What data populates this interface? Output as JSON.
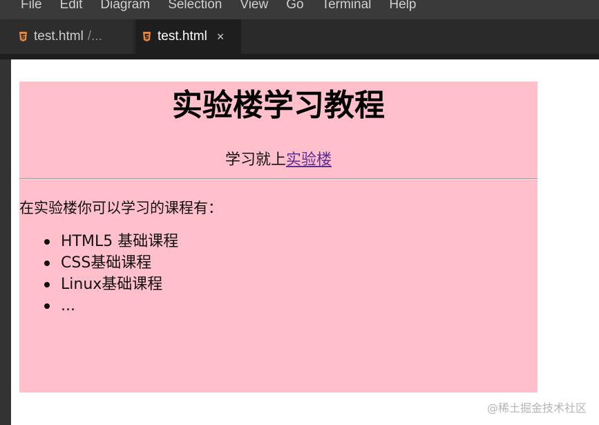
{
  "menubar": {
    "items": [
      "File",
      "Edit",
      "Diagram",
      "Selection",
      "View",
      "Go",
      "Terminal",
      "Help"
    ]
  },
  "tabs": [
    {
      "label": "test.html",
      "path": "/...",
      "icon": "html5-icon",
      "active": false
    },
    {
      "label": "test.html",
      "icon": "html5-icon",
      "close": "×",
      "active": true
    }
  ],
  "page": {
    "title": "实验楼学习教程",
    "tagline_prefix": "学习就上",
    "tagline_link": "实验楼",
    "intro": "在实验楼你可以学习的课程有：",
    "courses": [
      "HTML5 基础课程",
      "CSS基础课程",
      "Linux基础课程",
      "..."
    ]
  },
  "watermark": "@稀土掘金技术社区",
  "colors": {
    "page_background": "#ffc0cb",
    "link": "#5a2d91",
    "html5_icon": "#e8863a"
  }
}
